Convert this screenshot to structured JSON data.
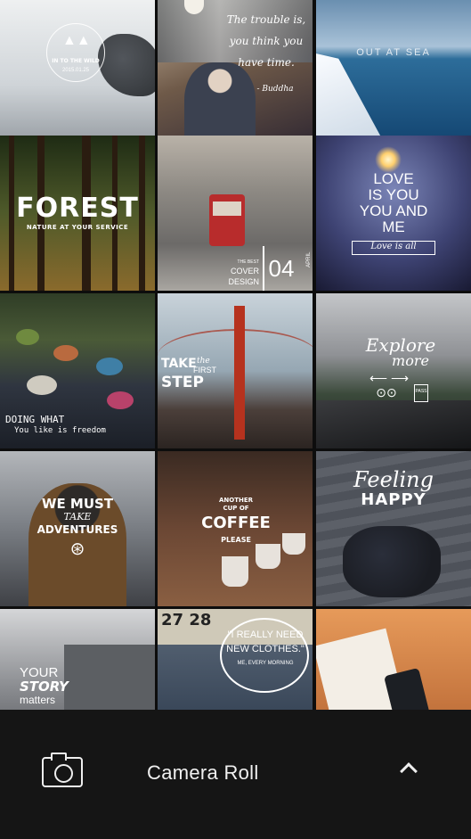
{
  "tiles": [
    {
      "id": 0,
      "lines": [
        "IN TO THE WILD",
        "2015.01.25"
      ]
    },
    {
      "id": 1,
      "lines": [
        "The trouble is,",
        "you think you",
        "have time.",
        "- Buddha"
      ]
    },
    {
      "id": 2,
      "lines": [
        "OUT AT SEA"
      ]
    },
    {
      "id": 3,
      "lines": [
        "FOREST",
        "NATURE AT YOUR SERVICE"
      ]
    },
    {
      "id": 4,
      "lines": [
        "THE BEST",
        "COVER",
        "DESIGN",
        "04",
        "APRIL"
      ]
    },
    {
      "id": 5,
      "lines": [
        "LOVE",
        "IS YOU",
        "YOU AND",
        "ME",
        "Love is all"
      ]
    },
    {
      "id": 6,
      "lines": [
        "DOING WHAT",
        "You like is freedom"
      ]
    },
    {
      "id": 7,
      "lines": [
        "TAKE",
        "the",
        "FIRST",
        "STEP"
      ]
    },
    {
      "id": 8,
      "lines": [
        "Explore",
        "more",
        "PASS"
      ]
    },
    {
      "id": 9,
      "lines": [
        "WE MUST",
        "TAKE",
        "ADVENTURES"
      ]
    },
    {
      "id": 10,
      "lines": [
        "ANOTHER",
        "CUP OF",
        "COFFEE",
        "PLEASE"
      ]
    },
    {
      "id": 11,
      "lines": [
        "Feeling",
        "HAPPY"
      ]
    },
    {
      "id": 12,
      "lines": [
        "YOUR",
        "STORY",
        "matters"
      ]
    },
    {
      "id": 13,
      "lines": [
        "27 28",
        "\"I REALLY NEED",
        "NEW CLOTHES.\"",
        "ME, EVERY MORNING"
      ]
    },
    {
      "id": 14,
      "lines": []
    }
  ],
  "bottom_bar": {
    "camera_icon": "camera-icon",
    "album_label": "Camera Roll",
    "chevron_icon": "chevron-up-icon"
  }
}
